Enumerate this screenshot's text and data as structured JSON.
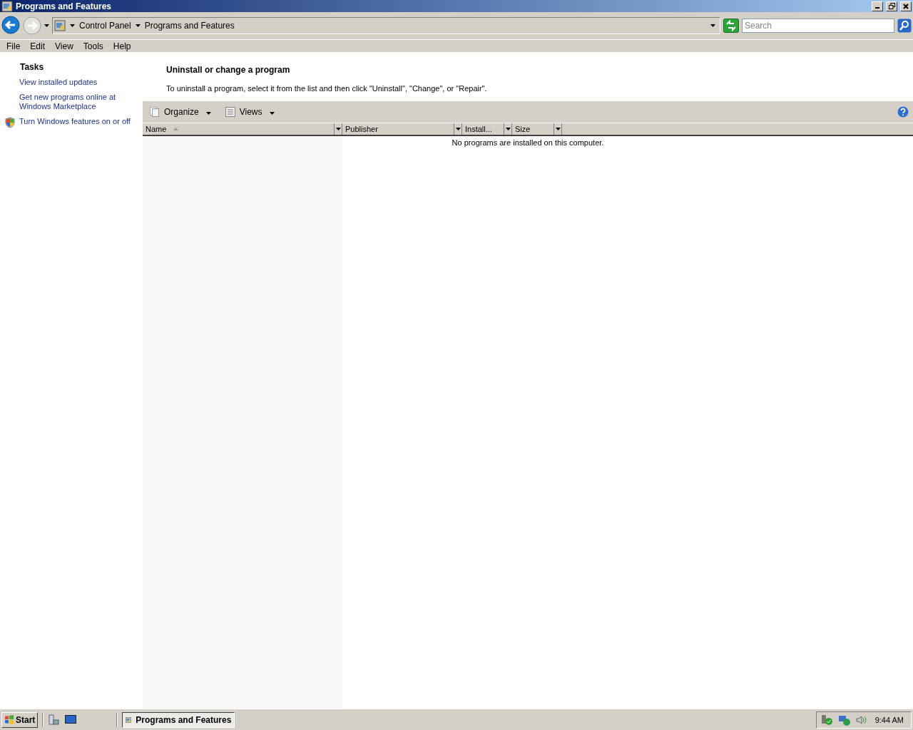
{
  "window": {
    "title": "Programs and Features"
  },
  "address_bar": {
    "breadcrumbs": [
      "Control Panel",
      "Programs and Features"
    ]
  },
  "search": {
    "placeholder": "Search"
  },
  "menu": [
    "File",
    "Edit",
    "View",
    "Tools",
    "Help"
  ],
  "tasks": {
    "title": "Tasks",
    "links": [
      {
        "label": "View installed updates",
        "kind": "link"
      },
      {
        "label": "Get new programs online at Windows Marketplace",
        "kind": "link"
      },
      {
        "label": "Turn Windows features on or off",
        "kind": "shield"
      }
    ]
  },
  "main": {
    "heading": "Uninstall or change a program",
    "description": "To uninstall a program, select it from the list and then click \"Uninstall\", \"Change\", or \"Repair\"."
  },
  "toolbar": [
    {
      "label": "Organize",
      "kind": "organize"
    },
    {
      "label": "Views",
      "kind": "views"
    }
  ],
  "table": {
    "columns": [
      {
        "label": "Name",
        "sorted": true
      },
      {
        "label": "Publisher",
        "sorted": false
      },
      {
        "label": "Install...",
        "sorted": false
      },
      {
        "label": "Size",
        "sorted": false
      }
    ],
    "empty_message": "No programs are installed on this computer."
  },
  "taskbar": {
    "start": "Start",
    "tasks": [
      {
        "label": "Programs and Features",
        "selected": true
      }
    ],
    "clock": "9:44 AM"
  }
}
